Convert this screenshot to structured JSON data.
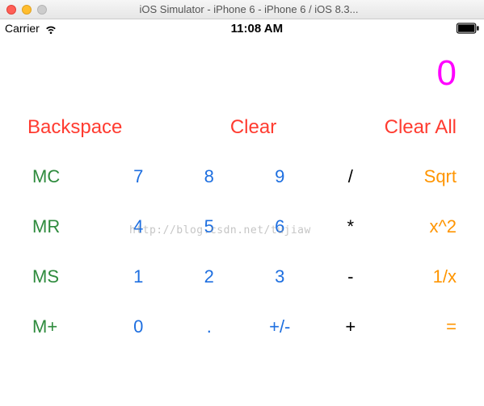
{
  "window": {
    "title": "iOS Simulator - iPhone 6 - iPhone 6 / iOS 8.3..."
  },
  "status_bar": {
    "carrier": "Carrier",
    "time": "11:08 AM"
  },
  "display": {
    "value": "0"
  },
  "top_row": {
    "backspace": "Backspace",
    "clear": "Clear",
    "clear_all": "Clear All"
  },
  "grid": [
    {
      "mem": "MC",
      "n1": "7",
      "n2": "8",
      "n3": "9",
      "op": "/",
      "fn": "Sqrt"
    },
    {
      "mem": "MR",
      "n1": "4",
      "n2": "5",
      "n3": "6",
      "op": "*",
      "fn": "x^2"
    },
    {
      "mem": "MS",
      "n1": "1",
      "n2": "2",
      "n3": "3",
      "op": "-",
      "fn": "1/x"
    },
    {
      "mem": "M+",
      "n1": "0",
      "n2": ".",
      "n3": "+/-",
      "op": "+",
      "fn": "="
    }
  ],
  "watermark": "http://blog.csdn.net/tujiaw"
}
